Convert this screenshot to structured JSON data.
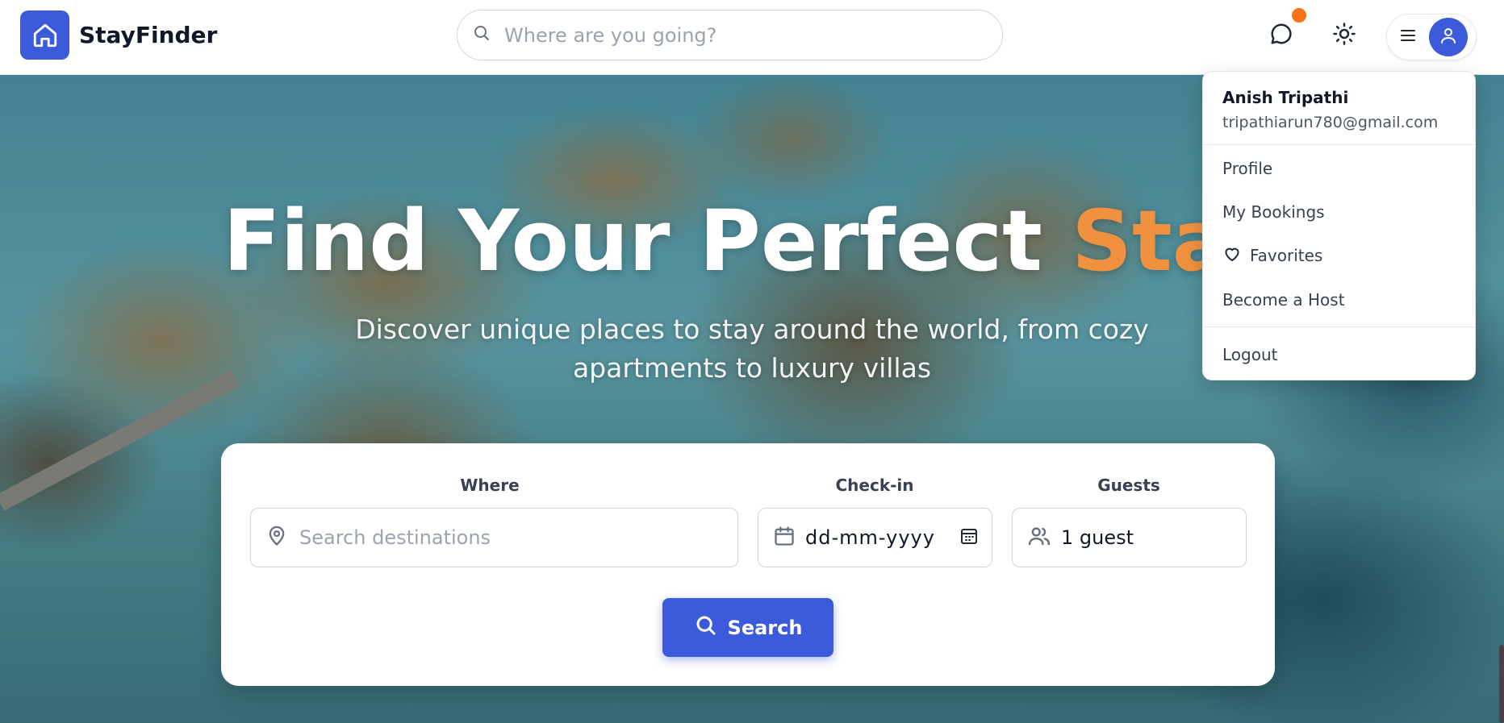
{
  "brand": {
    "name": "StayFinder"
  },
  "header": {
    "search_placeholder": "Where are you going?"
  },
  "hero": {
    "title_main": "Find Your Perfect",
    "title_accent": "Stay",
    "subtitle_line1": "Discover unique places to stay around the world, from cozy",
    "subtitle_line2": "apartments to luxury villas"
  },
  "search_card": {
    "where_label": "Where",
    "where_placeholder": "Search destinations",
    "checkin_label": "Check-in",
    "checkin_value": "dd-mm-yyyy",
    "guests_label": "Guests",
    "guests_value": "1 guest",
    "search_button": "Search"
  },
  "user_menu": {
    "name": "Anish Tripathi",
    "email": "tripathiarun780@gmail.com",
    "items": [
      {
        "label": "Profile"
      },
      {
        "label": "My Bookings"
      },
      {
        "label": "Favorites"
      },
      {
        "label": "Become a Host"
      },
      {
        "label": "Logout"
      }
    ]
  },
  "colors": {
    "primary": "#3b5bdb",
    "accent": "#f0913f",
    "notification": "#f97316"
  },
  "icons": [
    "home-icon",
    "search-icon",
    "chat-icon",
    "sun-icon",
    "menu-icon",
    "user-icon",
    "map-pin-icon",
    "calendar-icon",
    "users-icon",
    "heart-icon"
  ]
}
